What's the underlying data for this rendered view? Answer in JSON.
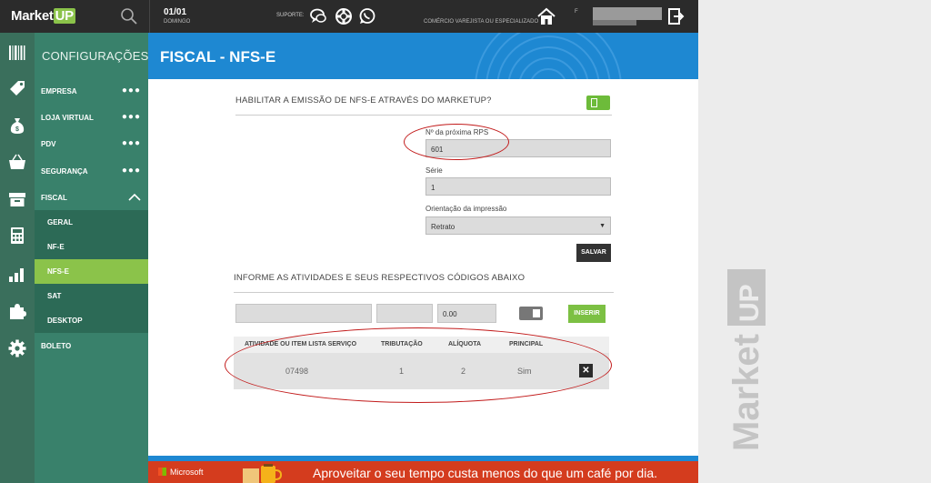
{
  "topbar": {
    "logo_text": "Market",
    "logo_up": "UP",
    "date": "01/01",
    "day": "DOMINGO",
    "support_label": "SUPORTE:",
    "plan": "COMÉRCIO VAREJISTA OU ESPECIALIZADO",
    "user_initial": "F",
    "icons": [
      "search-icon",
      "chat-icon",
      "lifebuoy-icon",
      "whatsapp-icon",
      "home-icon",
      "logout-icon"
    ]
  },
  "sidebar_icons": [
    "barcode-icon",
    "tag-icon",
    "money-bag-icon",
    "basket-icon",
    "box-icon",
    "calculator-icon",
    "bar-chart-icon",
    "puzzle-icon",
    "gear-icon"
  ],
  "menu": {
    "title": "CONFIGURAÇÕES",
    "items": [
      {
        "label": "EMPRESA"
      },
      {
        "label": "LOJA VIRTUAL"
      },
      {
        "label": "PDV"
      },
      {
        "label": "SEGURANÇA"
      },
      {
        "label": "FISCAL"
      },
      {
        "label": "BOLETO"
      }
    ],
    "fiscal_submenu": [
      {
        "label": "GERAL"
      },
      {
        "label": "NF-E"
      },
      {
        "label": "NFS-E"
      },
      {
        "label": "SAT"
      },
      {
        "label": "DESKTOP"
      }
    ]
  },
  "page": {
    "title": "FISCAL - NFS-E",
    "enable_label": "HABILITAR A EMISSÃO DE NFS-E ATRAVÉS DO MARKETUP?",
    "fields": {
      "rps_label": "Nº da próxima RPS",
      "rps_value": "601",
      "serie_label": "Série",
      "serie_value": "1",
      "orientation_label": "Orientação da impressão",
      "orientation_value": "Retrato"
    },
    "save_label": "SALVAR",
    "activities_label": "INFORME AS ATIVIDADES E SEUS RESPECTIVOS CÓDIGOS ABAIXO",
    "aliquota_default": "0.00",
    "insert_label": "INSERIR",
    "table": {
      "headers": [
        "ATIVIDADE OU ITEM LISTA SERVIÇO",
        "TRIBUTAÇÃO",
        "ALÍQUOTA",
        "PRINCIPAL"
      ],
      "rows": [
        [
          "07498",
          "1",
          "2",
          "Sim"
        ]
      ]
    }
  },
  "ad": {
    "brand": "Microsoft",
    "text": "Aproveitar o seu tempo custa menos do que um café por dia."
  },
  "watermark": {
    "text_market": "Market",
    "text_up": "UP"
  },
  "colors": {
    "topbar": "#2b2b2b",
    "menu": "#39816b",
    "accent_green": "#8bc34a",
    "header_blue": "#1e88d2",
    "annotation_red": "#c21b1b",
    "ad_red": "#d43c1e"
  }
}
